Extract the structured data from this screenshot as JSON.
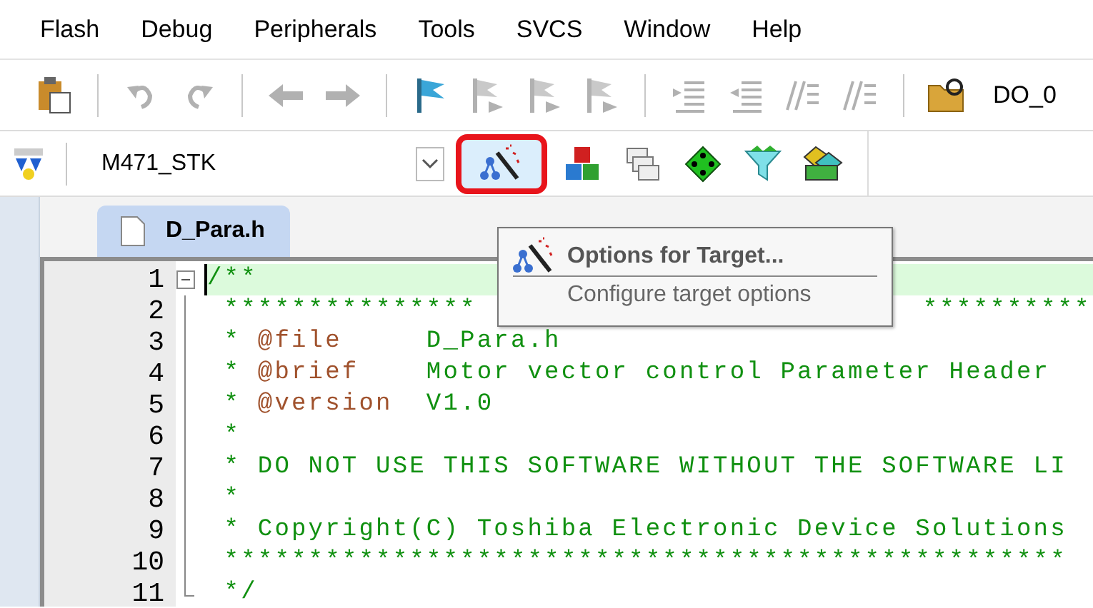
{
  "menu": [
    {
      "label": "Flash"
    },
    {
      "label": "Debug"
    },
    {
      "label": "Peripherals"
    },
    {
      "label": "Tools"
    },
    {
      "label": "SVCS"
    },
    {
      "label": "Window"
    },
    {
      "label": "Help"
    }
  ],
  "toolbar": [
    {
      "kind": "paste",
      "disabled": false
    },
    {
      "kind": "separator"
    },
    {
      "kind": "undo",
      "disabled": true
    },
    {
      "kind": "redo",
      "disabled": true
    },
    {
      "kind": "separator"
    },
    {
      "kind": "back",
      "disabled": true
    },
    {
      "kind": "forward",
      "disabled": true
    },
    {
      "kind": "separator"
    },
    {
      "kind": "flag",
      "disabled": false
    },
    {
      "kind": "bookmark-prev",
      "disabled": true
    },
    {
      "kind": "bookmark-next",
      "disabled": true
    },
    {
      "kind": "bookmark-clear",
      "disabled": true
    },
    {
      "kind": "separator"
    },
    {
      "kind": "indent",
      "disabled": true
    },
    {
      "kind": "unindent",
      "disabled": true
    },
    {
      "kind": "comment",
      "disabled": true
    },
    {
      "kind": "uncomment",
      "disabled": true
    },
    {
      "kind": "separator"
    },
    {
      "kind": "find-folder",
      "disabled": false
    },
    {
      "kind": "find-text",
      "label": "DO_0"
    }
  ],
  "build_toolbar": {
    "target": "M471_STK",
    "buttons": [
      {
        "kind": "options",
        "highlighted": true
      },
      {
        "kind": "components",
        "highlighted": false
      },
      {
        "kind": "windows",
        "highlighted": false
      },
      {
        "kind": "green-diamond",
        "highlighted": false
      },
      {
        "kind": "funnel",
        "highlighted": false
      },
      {
        "kind": "packs",
        "highlighted": false
      }
    ]
  },
  "tabs": [
    {
      "label": "D_Para.h",
      "selected": true
    }
  ],
  "tooltip": {
    "title": "Options for Target...",
    "description": "Configure target options"
  },
  "code_lines": [
    {
      "number": "1",
      "current": true,
      "parts": [
        {
          "kind": "comment",
          "text": "/**"
        }
      ]
    },
    {
      "number": "2",
      "current": false,
      "parts": [
        {
          "kind": "comment",
          "text": " ***************"
        },
        {
          "kind": "covered"
        },
        {
          "kind": "comment",
          "text": "**********"
        }
      ]
    },
    {
      "number": "3",
      "current": false,
      "parts": [
        {
          "kind": "comment",
          "text": " * "
        },
        {
          "kind": "tag",
          "text": "@file"
        },
        {
          "kind": "comment",
          "text": "     D_Para.h"
        }
      ]
    },
    {
      "number": "4",
      "current": false,
      "parts": [
        {
          "kind": "comment",
          "text": " * "
        },
        {
          "kind": "tag",
          "text": "@brief"
        },
        {
          "kind": "comment",
          "text": "    Motor vector control Parameter Header"
        }
      ]
    },
    {
      "number": "5",
      "current": false,
      "parts": [
        {
          "kind": "comment",
          "text": " * "
        },
        {
          "kind": "tag",
          "text": "@version"
        },
        {
          "kind": "comment",
          "text": "  V1.0"
        }
      ]
    },
    {
      "number": "6",
      "current": false,
      "parts": [
        {
          "kind": "comment",
          "text": " *"
        }
      ]
    },
    {
      "number": "7",
      "current": false,
      "parts": [
        {
          "kind": "comment",
          "text": " * DO NOT USE THIS SOFTWARE WITHOUT THE SOFTWARE LI"
        }
      ]
    },
    {
      "number": "8",
      "current": false,
      "parts": [
        {
          "kind": "comment",
          "text": " *"
        }
      ]
    },
    {
      "number": "9",
      "current": false,
      "parts": [
        {
          "kind": "comment",
          "text": " * Copyright(C) Toshiba Electronic Device Solutions"
        }
      ]
    },
    {
      "number": "10",
      "current": false,
      "parts": [
        {
          "kind": "comment",
          "text": " **************************************************"
        }
      ]
    },
    {
      "number": "11",
      "current": false,
      "parts": [
        {
          "kind": "comment",
          "text": " */"
        }
      ]
    }
  ]
}
